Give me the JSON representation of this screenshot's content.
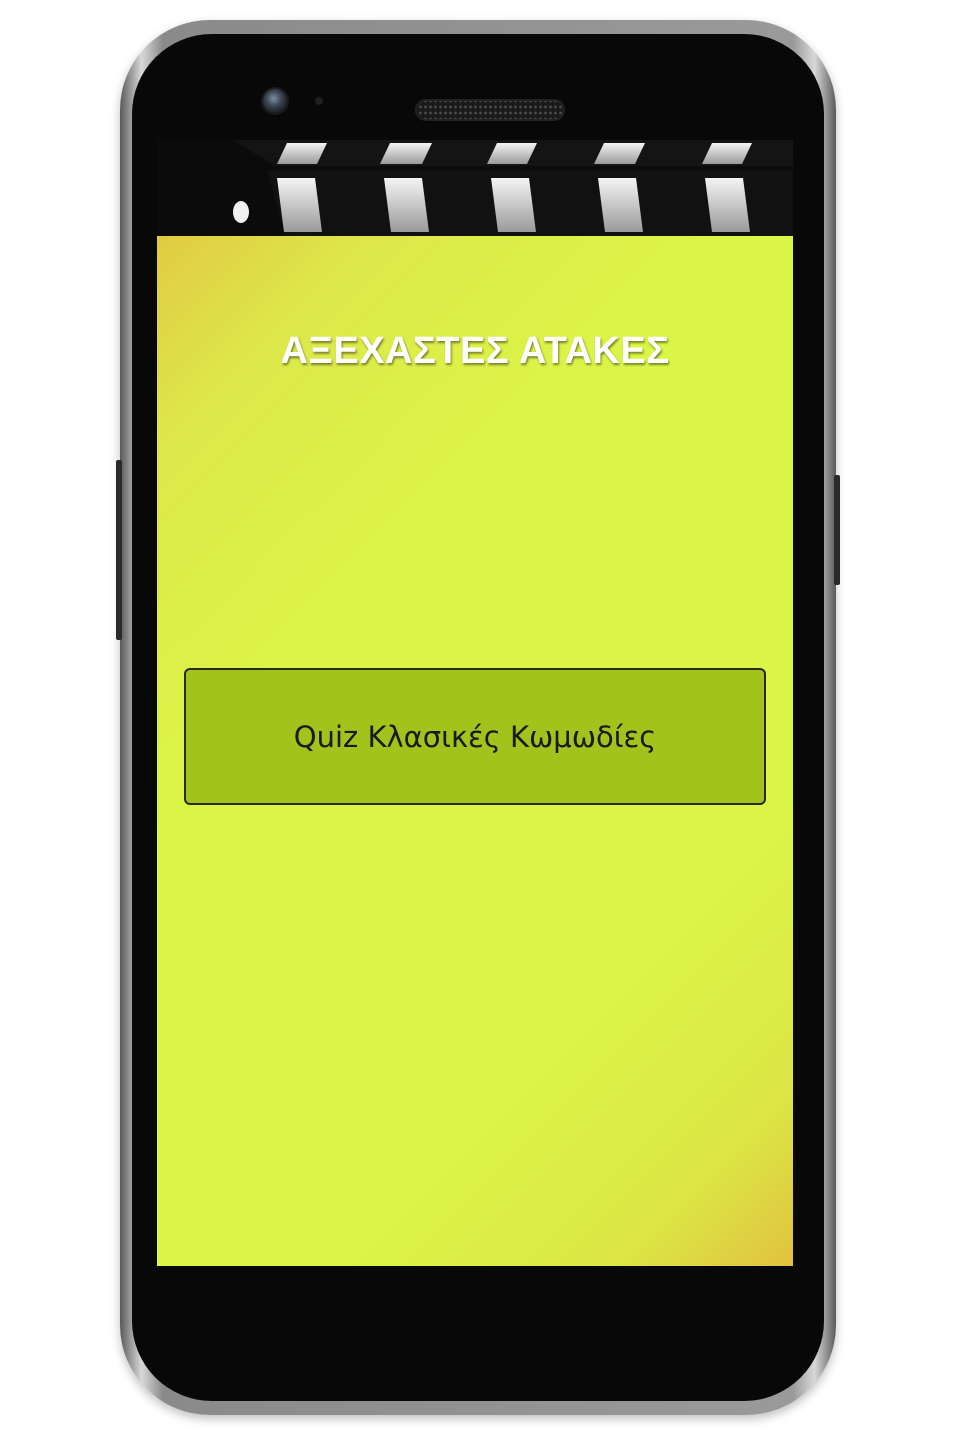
{
  "app": {
    "title": "ΑΞΕΧΑΣΤΕΣ ΑΤΑΚΕΣ",
    "quiz_button_label": "Quiz Κλασικές Κωμωδίες"
  },
  "colors": {
    "background_yellow": "#dbf646",
    "background_gold": "#e1c23f",
    "button_green": "#a2c31b",
    "title_text": "#ffffff"
  },
  "icons": [
    "clapperboard-icon",
    "camera-icon",
    "speaker-grille-icon"
  ]
}
